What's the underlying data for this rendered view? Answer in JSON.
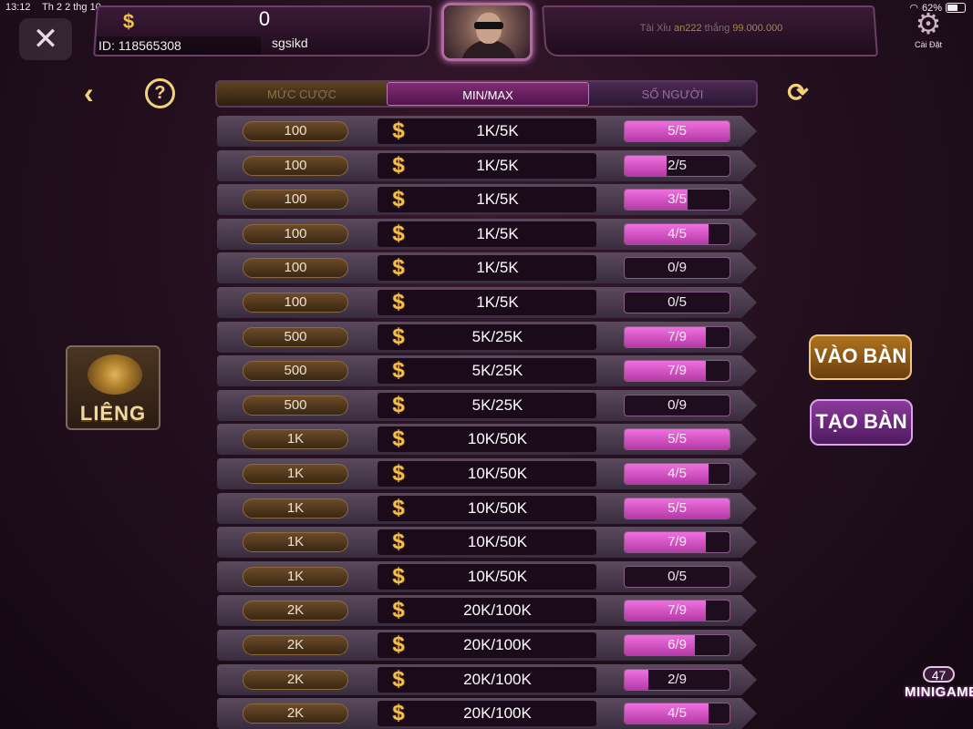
{
  "status_bar": {
    "time": "13:12",
    "date": "Th 2 2 thg 10",
    "battery": "62%"
  },
  "wallet": {
    "currency_icon": "$",
    "balance": "0",
    "id": "ID: 118565308",
    "username": "sgsikd"
  },
  "notice": {
    "game": "Tài Xỉu",
    "player": "an222",
    "verb": "thắng",
    "amount": "99.000.000"
  },
  "settings": {
    "label": "Cài Đặt"
  },
  "header": {
    "col1": "MỨC CƯỢC",
    "col2": "MIN/MAX",
    "col3": "SỐ NGƯỜI"
  },
  "rows": [
    {
      "bet": "100",
      "minmax": "1K/5K",
      "players": "5/5",
      "fill": 1.0
    },
    {
      "bet": "100",
      "minmax": "1K/5K",
      "players": "2/5",
      "fill": 0.4
    },
    {
      "bet": "100",
      "minmax": "1K/5K",
      "players": "3/5",
      "fill": 0.6
    },
    {
      "bet": "100",
      "minmax": "1K/5K",
      "players": "4/5",
      "fill": 0.8
    },
    {
      "bet": "100",
      "minmax": "1K/5K",
      "players": "0/9",
      "fill": 0.0
    },
    {
      "bet": "100",
      "minmax": "1K/5K",
      "players": "0/5",
      "fill": 0.0
    },
    {
      "bet": "500",
      "minmax": "5K/25K",
      "players": "7/9",
      "fill": 0.778
    },
    {
      "bet": "500",
      "minmax": "5K/25K",
      "players": "7/9",
      "fill": 0.778
    },
    {
      "bet": "500",
      "minmax": "5K/25K",
      "players": "0/9",
      "fill": 0.0
    },
    {
      "bet": "1K",
      "minmax": "10K/50K",
      "players": "5/5",
      "fill": 1.0
    },
    {
      "bet": "1K",
      "minmax": "10K/50K",
      "players": "4/5",
      "fill": 0.8
    },
    {
      "bet": "1K",
      "minmax": "10K/50K",
      "players": "5/5",
      "fill": 1.0
    },
    {
      "bet": "1K",
      "minmax": "10K/50K",
      "players": "7/9",
      "fill": 0.778
    },
    {
      "bet": "1K",
      "minmax": "10K/50K",
      "players": "0/5",
      "fill": 0.0
    },
    {
      "bet": "2K",
      "minmax": "20K/100K",
      "players": "7/9",
      "fill": 0.778
    },
    {
      "bet": "2K",
      "minmax": "20K/100K",
      "players": "6/9",
      "fill": 0.667
    },
    {
      "bet": "2K",
      "minmax": "20K/100K",
      "players": "2/9",
      "fill": 0.222
    },
    {
      "bet": "2K",
      "minmax": "20K/100K",
      "players": "4/5",
      "fill": 0.8
    }
  ],
  "game": {
    "name": "LIÊNG"
  },
  "actions": {
    "join": "VÀO BÀN",
    "create": "TẠO BÀN"
  },
  "minigame": {
    "count": "47",
    "label": "MINIGAME"
  },
  "colors": {
    "accent_gold": "#f4d27c",
    "accent_pink": "#e25ad3",
    "bg": "#24101f"
  }
}
